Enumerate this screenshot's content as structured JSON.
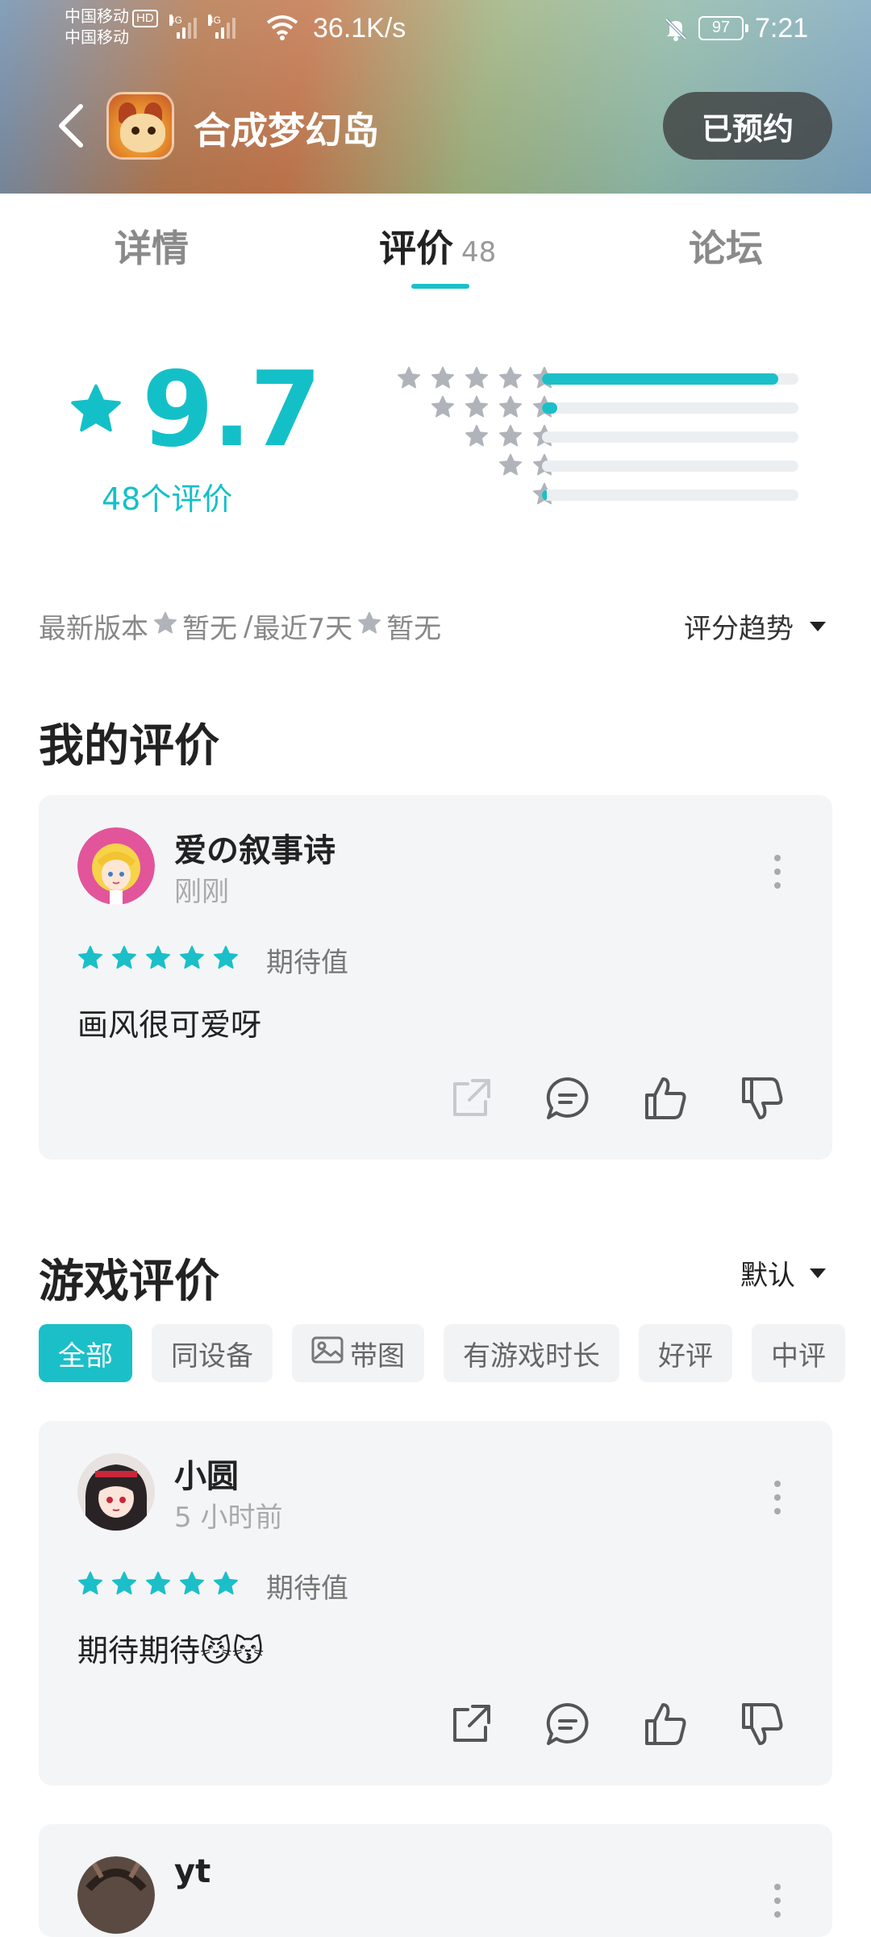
{
  "status_bar": {
    "carrier_1": "中国移动",
    "hd_badge": "HD",
    "carrier_2": "中国移动",
    "network_1": "4G",
    "network_2": "4G",
    "speed": "36.1K/s",
    "battery": "97",
    "time": "7:21"
  },
  "header": {
    "app_name": "合成梦幻岛",
    "reserve_button": "已预约"
  },
  "tabs": {
    "details": "详情",
    "reviews": "评价",
    "reviews_count": "48",
    "forum": "论坛"
  },
  "rating": {
    "score": "9.7",
    "count_label": "48个评价",
    "distribution": [
      {
        "stars": 5,
        "fraction": 0.92
      },
      {
        "stars": 4,
        "fraction": 0.06
      },
      {
        "stars": 3,
        "fraction": 0.0
      },
      {
        "stars": 2,
        "fraction": 0.0
      },
      {
        "stars": 1,
        "fraction": 0.02
      }
    ]
  },
  "recent": {
    "latest_version_label": "最新版本",
    "latest_version_value": "暂无",
    "separator": "/",
    "recent_7_days_label": "最近7天",
    "recent_7_days_value": "暂无",
    "trend_label": "评分趋势"
  },
  "my_review": {
    "section_title": "我的评价",
    "user": "爱の叙事诗",
    "time": "刚刚",
    "stars": 5,
    "label": "期待值",
    "text": "画风很可爱呀"
  },
  "game_reviews": {
    "section_title": "游戏评价",
    "sort_label": "默认",
    "filters": [
      "全部",
      "同设备",
      "带图",
      "有游戏时长",
      "好评",
      "中评"
    ],
    "active_filter": "全部",
    "items": [
      {
        "user": "小圆",
        "time": "5 小时前",
        "stars": 5,
        "label": "期待值",
        "text": "期待期待😼😽"
      },
      {
        "user": "yt"
      }
    ]
  },
  "colors": {
    "accent": "#1bbfc8",
    "card_bg": "#f4f5f7",
    "muted_text": "#888888"
  }
}
